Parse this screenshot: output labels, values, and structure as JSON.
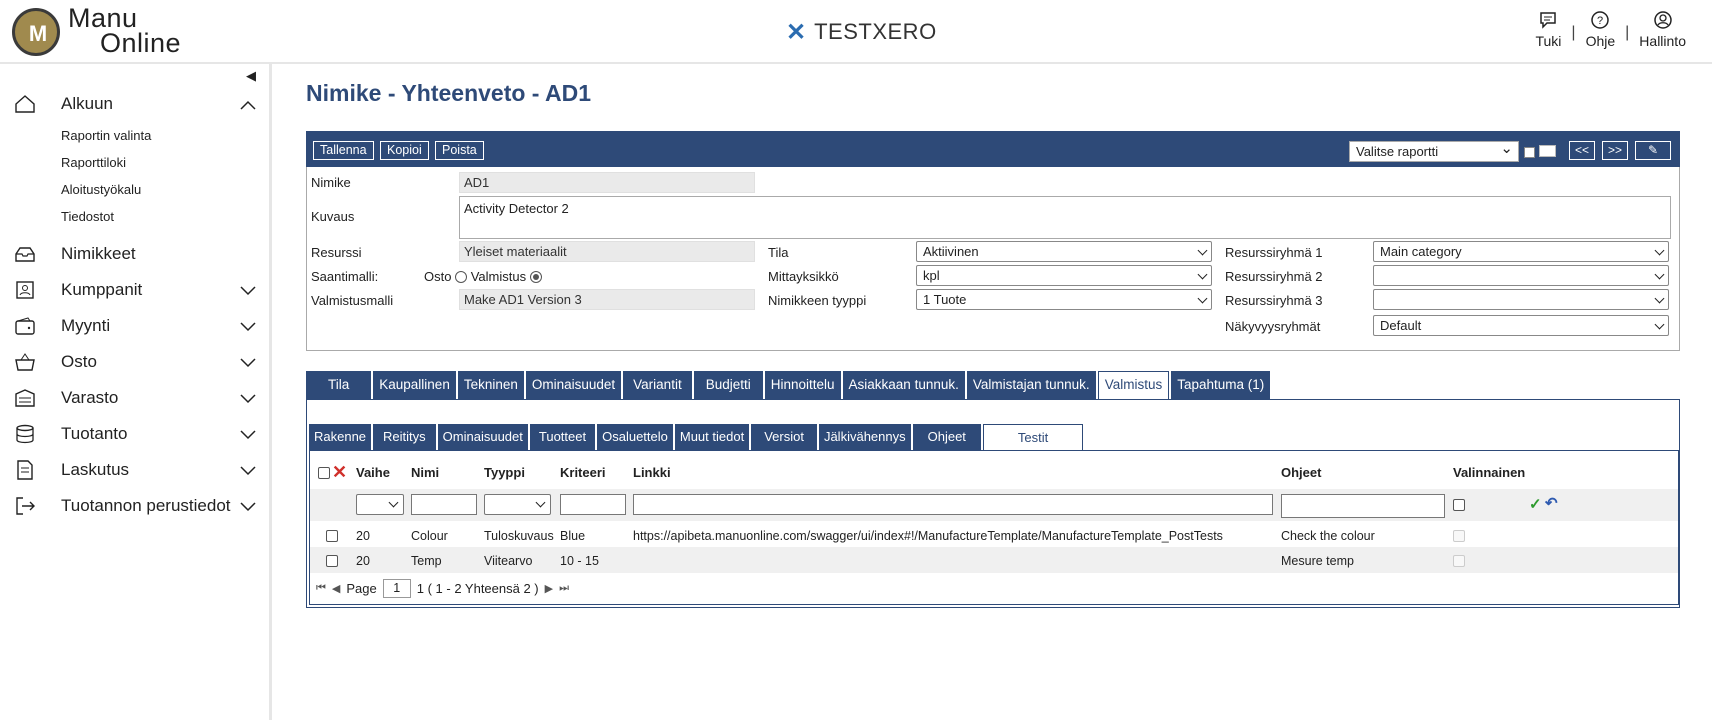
{
  "app": {
    "logo_line1": "Manu",
    "logo_line2": "Online",
    "center_title": "TESTXERO",
    "top_nav": [
      {
        "label": "Tuki",
        "icon": "chat-icon"
      },
      {
        "label": "Ohje",
        "icon": "help-icon"
      },
      {
        "label": "Hallinto",
        "icon": "user-icon"
      }
    ],
    "separator": "|"
  },
  "sidebar": {
    "items": [
      {
        "label": "Alkuun",
        "icon": "home-icon",
        "expanded": true
      },
      {
        "label": "Nimikkeet",
        "icon": "inbox-icon"
      },
      {
        "label": "Kumppanit",
        "icon": "contacts-icon"
      },
      {
        "label": "Myynti",
        "icon": "wallet-icon"
      },
      {
        "label": "Osto",
        "icon": "basket-icon"
      },
      {
        "label": "Varasto",
        "icon": "warehouse-icon"
      },
      {
        "label": "Tuotanto",
        "icon": "database-icon"
      },
      {
        "label": "Laskutus",
        "icon": "document-icon"
      },
      {
        "label": "Tuotannon perustiedot",
        "icon": "sign-in-icon"
      }
    ],
    "subitems": [
      "Raportin valinta",
      "Raporttiloki",
      "Aloitustyökalu",
      "Tiedostot"
    ]
  },
  "page": {
    "title": "Nimike - Yhteenveto - AD1",
    "toolbar": {
      "save": "Tallenna",
      "copy": "Kopioi",
      "delete": "Poista",
      "report_select": "Valitse raportti",
      "prev": "<<",
      "next": ">>",
      "attach": "✎"
    },
    "form": {
      "nimike_label": "Nimike",
      "nimike_value": "AD1",
      "kuvaus_label": "Kuvaus",
      "kuvaus_value": "Activity Detector 2",
      "resurssi_label": "Resurssi",
      "resurssi_value": "Yleiset materiaalit",
      "saantimalli_label": "Saantimalli:",
      "osto_label": "Osto",
      "valmistus_label": "Valmistus",
      "valmistusmalli_label": "Valmistusmalli",
      "valmistusmalli_value": "Make AD1 Version 3",
      "tila_label": "Tila",
      "tila_value": "Aktiivinen",
      "mittayksikko_label": "Mittayksikkö",
      "mittayksikko_value": "kpl",
      "tyyppi_label": "Nimikkeen tyyppi",
      "tyyppi_value": "1 Tuote",
      "rr1_label": "Resurssiryhmä 1",
      "rr1_value": "Main category",
      "rr2_label": "Resurssiryhmä 2",
      "rr2_value": "",
      "rr3_label": "Resurssiryhmä 3",
      "rr3_value": "",
      "nakyvyys_label": "Näkyvyysryhmät",
      "nakyvyys_value": "Default"
    },
    "tabs": [
      "Tila",
      "Kaupallinen",
      "Tekninen",
      "Ominaisuudet",
      "Variantit",
      "Budjetti",
      "Hinnoittelu",
      "Asiakkaan tunnuk.",
      "Valmistajan tunnuk.",
      "Valmistus",
      "Tapahtuma (1)"
    ],
    "active_tab": "Valmistus",
    "subtabs": [
      "Rakenne",
      "Reititys",
      "Ominaisuudet",
      "Tuotteet",
      "Osaluettelo",
      "Muut tiedot",
      "Versiot",
      "Jälkivähennys",
      "Ohjeet",
      "Testit"
    ],
    "active_subtab": "Testit",
    "grid": {
      "columns": [
        "Vaihe",
        "Nimi",
        "Tyyppi",
        "Kriteeri",
        "Linkki",
        "Ohjeet",
        "Valinnainen"
      ],
      "rows": [
        {
          "vaihe": "20",
          "nimi": "Colour",
          "tyyppi": "Tuloskuvaus",
          "kriteeri": "Blue",
          "linkki": "https://apibeta.manuonline.com/swagger/ui/index#!/ManufactureTemplate/ManufactureTemplate_PostTests",
          "ohjeet": "Check the colour"
        },
        {
          "vaihe": "20",
          "nimi": "Temp",
          "tyyppi": "Viitearvo",
          "kriteeri": "10 - 15",
          "linkki": "",
          "ohjeet": "Mesure temp"
        }
      ],
      "pager": {
        "page_label": "Page",
        "page": "1",
        "summary": "1 ( 1 - 2 Yhteensä 2 )"
      }
    }
  }
}
